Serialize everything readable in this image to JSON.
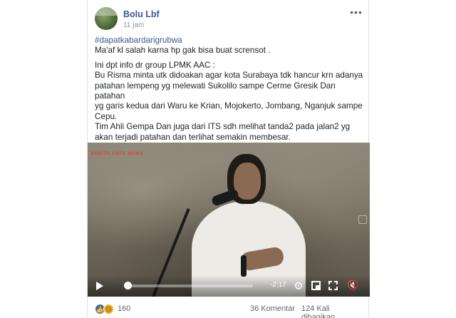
{
  "post": {
    "author": "Bolu Lbf",
    "time": "11 jam",
    "more_label": "•••",
    "hashtag": "#dapatkabardarigrubwa",
    "lines": [
      "Ma'af kl salah karna hp gak bisa buat scrensot .",
      "Ini dpt info dr group LPMK AAC :",
      "Bu Risma minta utk didoakan agar kota Surabaya tdk hancur krn adanya",
      "patahan lempeng yg melewati Sukolilo sampe Cerme Gresik Dan patahan",
      "yg garis kedua dari Waru ke Krian, Mojokerto, Jombang, Nganjuk sampe",
      "Cepu.",
      "Tim Ahli Gempa Dan juga dari ITS sdh melihat tanda2 pada jalan2 yg",
      "akan terjadi patahan dan terlihat semakin membesar."
    ]
  },
  "video": {
    "watermark": "BERITA SATU NEWS",
    "remaining_time": "-2:17",
    "progress": 0.02,
    "icons": {
      "play": "play-icon",
      "settings": "gear-icon",
      "pip": "picture-in-picture-icon",
      "fullscreen": "fullscreen-icon",
      "volume": "mute-icon"
    }
  },
  "footer": {
    "reaction_count": "160",
    "comments": "36 Komentar",
    "shares": "124 Kali dibagikan",
    "reaction_icons": [
      "like-icon",
      "sad-icon"
    ]
  },
  "colors": {
    "link": "#385898",
    "meta": "#90949c",
    "like": "#4267b2",
    "sad": "#f7b125"
  }
}
